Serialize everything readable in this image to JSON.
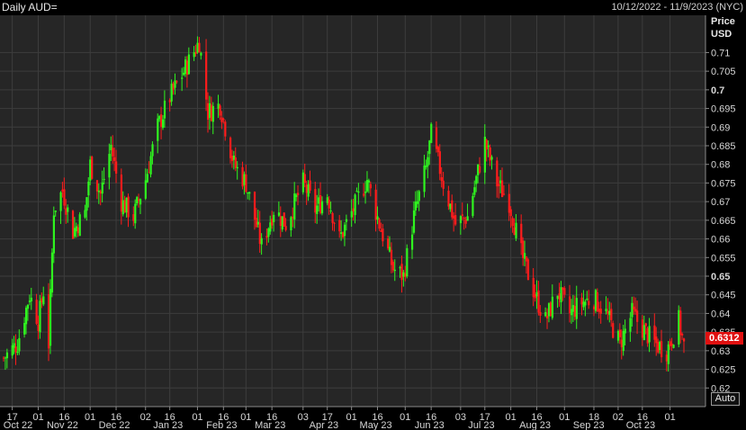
{
  "header": {
    "title": "Daily AUD=",
    "date_range": "10/12/2022 - 11/9/2023 (NYC)"
  },
  "price_axis": {
    "label_line1": "Price",
    "label_line2": "USD",
    "auto_button": "Auto",
    "last_price_tag": "0.6312"
  },
  "colors": {
    "background": "#262626",
    "grid": "#3d3d3d",
    "up": "#2ff51f",
    "down": "#ff1c1c",
    "last_tag": "#e01010"
  },
  "chart_data": {
    "type": "candlestick",
    "title": "Daily AUD=",
    "y_unit": "USD",
    "ylim": [
      0.615,
      0.72
    ],
    "y_ticks": [
      0.62,
      0.625,
      0.63,
      0.635,
      0.64,
      0.645,
      0.65,
      0.655,
      0.66,
      0.665,
      0.67,
      0.675,
      0.68,
      0.685,
      0.69,
      0.695,
      0.7,
      0.705,
      0.71
    ],
    "y_tick_labels": [
      "0.62",
      "0.625",
      "0.63",
      "0.635",
      "0.64",
      "0.645",
      "0.65",
      "0.655",
      "0.66",
      "0.665",
      "0.67",
      "0.675",
      "0.68",
      "0.685",
      "0.69",
      "0.695",
      "0.7",
      "0.705",
      "0.71"
    ],
    "y_bold_ticks": [
      "0.65",
      "0.7"
    ],
    "x_start": "2022-10-12",
    "x_end": "2023-11-09",
    "x_day_ticks": [
      {
        "date": "2022-10-17",
        "label": "17"
      },
      {
        "date": "2022-11-01",
        "label": "01"
      },
      {
        "date": "2022-11-16",
        "label": "16"
      },
      {
        "date": "2022-12-01",
        "label": "01"
      },
      {
        "date": "2022-12-16",
        "label": "16"
      },
      {
        "date": "2023-01-02",
        "label": "02"
      },
      {
        "date": "2023-01-16",
        "label": "16"
      },
      {
        "date": "2023-02-01",
        "label": "01"
      },
      {
        "date": "2023-02-16",
        "label": "16"
      },
      {
        "date": "2023-03-01",
        "label": "01"
      },
      {
        "date": "2023-03-16",
        "label": "16"
      },
      {
        "date": "2023-04-03",
        "label": "03"
      },
      {
        "date": "2023-04-17",
        "label": "17"
      },
      {
        "date": "2023-05-01",
        "label": "01"
      },
      {
        "date": "2023-05-16",
        "label": "16"
      },
      {
        "date": "2023-06-01",
        "label": "01"
      },
      {
        "date": "2023-06-16",
        "label": "16"
      },
      {
        "date": "2023-07-03",
        "label": "03"
      },
      {
        "date": "2023-07-17",
        "label": "17"
      },
      {
        "date": "2023-08-01",
        "label": "01"
      },
      {
        "date": "2023-08-16",
        "label": "16"
      },
      {
        "date": "2023-09-01",
        "label": "01"
      },
      {
        "date": "2023-09-18",
        "label": "18"
      },
      {
        "date": "2023-10-02",
        "label": "02"
      },
      {
        "date": "2023-10-16",
        "label": "16"
      },
      {
        "date": "2023-11-01",
        "label": "01"
      }
    ],
    "x_month_labels": [
      {
        "date": "2022-10-15",
        "label": "Oct 22"
      },
      {
        "date": "2022-11-15",
        "label": "Nov 22"
      },
      {
        "date": "2022-12-15",
        "label": "Dec 22"
      },
      {
        "date": "2023-01-15",
        "label": "Jan 23"
      },
      {
        "date": "2023-02-15",
        "label": "Feb 23"
      },
      {
        "date": "2023-03-15",
        "label": "Mar 23"
      },
      {
        "date": "2023-04-15",
        "label": "Apr 23"
      },
      {
        "date": "2023-05-15",
        "label": "May 23"
      },
      {
        "date": "2023-06-15",
        "label": "Jun 23"
      },
      {
        "date": "2023-07-15",
        "label": "Jul 23"
      },
      {
        "date": "2023-08-15",
        "label": "Aug 23"
      },
      {
        "date": "2023-09-15",
        "label": "Sep 23"
      },
      {
        "date": "2023-10-15",
        "label": "Oct 23"
      }
    ],
    "close_series": [
      {
        "date": "2022-10-12",
        "close": 0.628
      },
      {
        "date": "2022-10-20",
        "close": 0.632
      },
      {
        "date": "2022-10-27",
        "close": 0.645
      },
      {
        "date": "2022-11-01",
        "close": 0.638
      },
      {
        "date": "2022-11-04",
        "close": 0.646
      },
      {
        "date": "2022-11-07",
        "close": 0.632
      },
      {
        "date": "2022-11-10",
        "close": 0.668
      },
      {
        "date": "2022-11-15",
        "close": 0.673
      },
      {
        "date": "2022-11-21",
        "close": 0.662
      },
      {
        "date": "2022-11-28",
        "close": 0.667
      },
      {
        "date": "2022-12-01",
        "close": 0.68
      },
      {
        "date": "2022-12-07",
        "close": 0.672
      },
      {
        "date": "2022-12-13",
        "close": 0.685
      },
      {
        "date": "2022-12-19",
        "close": 0.67
      },
      {
        "date": "2022-12-26",
        "close": 0.666
      },
      {
        "date": "2023-01-02",
        "close": 0.676
      },
      {
        "date": "2023-01-09",
        "close": 0.69
      },
      {
        "date": "2023-01-16",
        "close": 0.698
      },
      {
        "date": "2023-01-23",
        "close": 0.704
      },
      {
        "date": "2023-02-02",
        "close": 0.713
      },
      {
        "date": "2023-02-07",
        "close": 0.694
      },
      {
        "date": "2023-02-14",
        "close": 0.696
      },
      {
        "date": "2023-02-22",
        "close": 0.68
      },
      {
        "date": "2023-03-01",
        "close": 0.675
      },
      {
        "date": "2023-03-10",
        "close": 0.658
      },
      {
        "date": "2023-03-17",
        "close": 0.668
      },
      {
        "date": "2023-03-24",
        "close": 0.664
      },
      {
        "date": "2023-04-03",
        "close": 0.675
      },
      {
        "date": "2023-04-10",
        "close": 0.668
      },
      {
        "date": "2023-04-17",
        "close": 0.672
      },
      {
        "date": "2023-04-24",
        "close": 0.66
      },
      {
        "date": "2023-05-02",
        "close": 0.668
      },
      {
        "date": "2023-05-10",
        "close": 0.676
      },
      {
        "date": "2023-05-17",
        "close": 0.664
      },
      {
        "date": "2023-05-25",
        "close": 0.652
      },
      {
        "date": "2023-05-31",
        "close": 0.65
      },
      {
        "date": "2023-06-06",
        "close": 0.666
      },
      {
        "date": "2023-06-13",
        "close": 0.679
      },
      {
        "date": "2023-06-16",
        "close": 0.688
      },
      {
        "date": "2023-06-23",
        "close": 0.675
      },
      {
        "date": "2023-06-30",
        "close": 0.664
      },
      {
        "date": "2023-07-07",
        "close": 0.666
      },
      {
        "date": "2023-07-14",
        "close": 0.68
      },
      {
        "date": "2023-07-17",
        "close": 0.686
      },
      {
        "date": "2023-07-24",
        "close": 0.675
      },
      {
        "date": "2023-07-31",
        "close": 0.67
      },
      {
        "date": "2023-08-07",
        "close": 0.656
      },
      {
        "date": "2023-08-15",
        "close": 0.645
      },
      {
        "date": "2023-08-21",
        "close": 0.638
      },
      {
        "date": "2023-08-28",
        "close": 0.646
      },
      {
        "date": "2023-09-04",
        "close": 0.64
      },
      {
        "date": "2023-09-11",
        "close": 0.643
      },
      {
        "date": "2023-09-18",
        "close": 0.644
      },
      {
        "date": "2023-09-25",
        "close": 0.64
      },
      {
        "date": "2023-10-03",
        "close": 0.632
      },
      {
        "date": "2023-10-10",
        "close": 0.64
      },
      {
        "date": "2023-10-16",
        "close": 0.636
      },
      {
        "date": "2023-10-23",
        "close": 0.632
      },
      {
        "date": "2023-10-30",
        "close": 0.63
      },
      {
        "date": "2023-11-06",
        "close": 0.638
      },
      {
        "date": "2023-11-09",
        "close": 0.6312
      }
    ]
  }
}
